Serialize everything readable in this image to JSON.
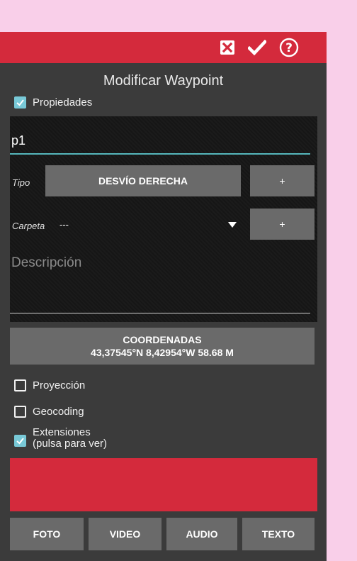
{
  "colors": {
    "accent_red": "#d42a3c",
    "check_teal": "#78c9d7",
    "input_line": "#55b6bb",
    "button_gray": "#6a6a6a"
  },
  "toolbar": {
    "icons": [
      "close-box-icon",
      "checkmark-icon",
      "help-circle-icon"
    ]
  },
  "title": "Modificar Waypoint",
  "properties": {
    "label": "Propiedades",
    "checked": true,
    "name_value": "p1",
    "type_label": "Tipo",
    "type_value": "DESVÍO DERECHA",
    "type_add": "+",
    "folder_label": "Carpeta",
    "folder_value": "---",
    "folder_add": "+",
    "description_placeholder": "Descripción"
  },
  "coordinates": {
    "title": "COORDENADAS",
    "value": "43,37545°N 8,42954°W 58.68 M"
  },
  "options": {
    "projection": {
      "label": "Proyección",
      "checked": false
    },
    "geocoding": {
      "label": "Geocoding",
      "checked": false
    },
    "extensions": {
      "label_line1": "Extensiones",
      "label_line2": "(pulsa para ver)",
      "checked": true
    }
  },
  "media_buttons": [
    "FOTO",
    "VIDEO",
    "AUDIO",
    "TEXTO"
  ]
}
